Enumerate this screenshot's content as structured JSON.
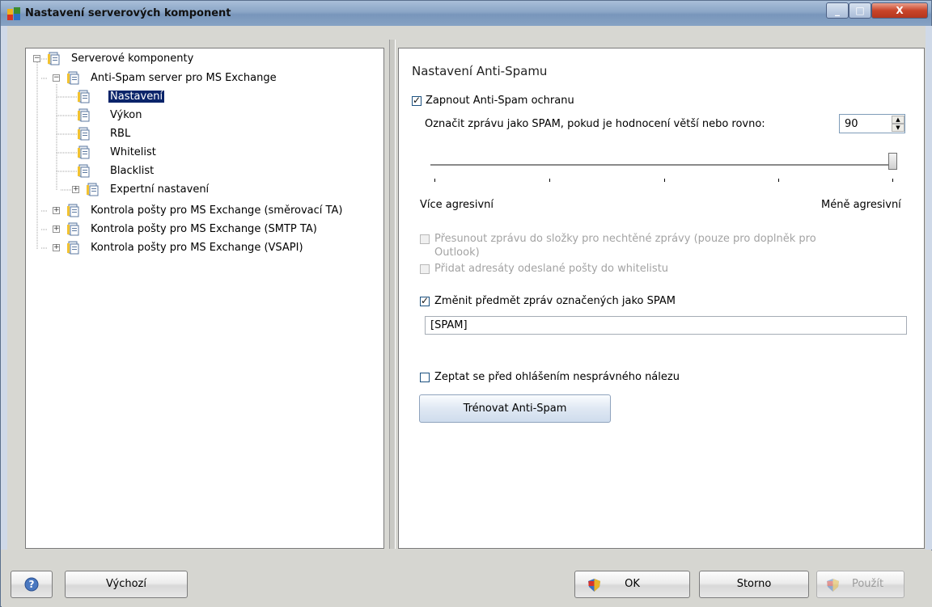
{
  "window": {
    "title": "Nastavení serverových komponent",
    "icon": "avg-app-icon",
    "controls": {
      "minimize": "minimize-icon",
      "maximize": "maximize-icon",
      "close": "close-icon"
    }
  },
  "tree": {
    "items": [
      {
        "label": "Serverové komponenty",
        "expander": "−",
        "level": 0
      },
      {
        "label": "Anti-Spam server pro MS Exchange",
        "expander": "−",
        "level": 1
      },
      {
        "label": "Nastavení",
        "level": 2,
        "selected": true
      },
      {
        "label": "Výkon",
        "level": 2
      },
      {
        "label": "RBL",
        "level": 2
      },
      {
        "label": "Whitelist",
        "level": 2
      },
      {
        "label": "Blacklist",
        "level": 2
      },
      {
        "label": "Expertní nastavení",
        "expander": "+",
        "level": 2
      },
      {
        "label": "Kontrola pošty pro MS Exchange (směrovací TA)",
        "expander": "+",
        "level": 1
      },
      {
        "label": "Kontrola pošty pro MS Exchange (SMTP TA)",
        "expander": "+",
        "level": 1
      },
      {
        "label": "Kontrola pošty pro MS Exchange (VSAPI)",
        "expander": "+",
        "level": 1
      }
    ]
  },
  "settings": {
    "title": "Nastavení Anti-Spamu",
    "enable_label": "Zapnout Anti-Spam ochranu",
    "enable_checked": true,
    "threshold_label": "Označit zprávu jako SPAM, pokud je hodnocení větší nebo rovno:",
    "threshold_value": "90",
    "slider": {
      "value": 90,
      "min": 0,
      "max": 100,
      "left_label": "Více agresivní",
      "right_label": "Méně agresivní"
    },
    "move_label": "Přesunout zprávu do složky pro nechtěné zprávy (pouze pro doplněk pro",
    "move_label_cont": "Outlook)",
    "move_checked": false,
    "add_whitelist_label": "Přidat adresáty odeslané pošty do whitelistu",
    "add_whitelist_checked": false,
    "subject_label": "Změnit předmět zpráv označených jako SPAM",
    "subject_checked": true,
    "subject_value": "[SPAM]",
    "ask_label": "Zeptat se před ohlášením nesprávného nálezu",
    "ask_checked": false,
    "train_button": "Trénovat Anti-Spam"
  },
  "footer": {
    "help_icon": "help-icon",
    "default_button": "Výchozí",
    "ok_button": "OK",
    "cancel_button": "Storno",
    "apply_button": "Použít"
  },
  "colors": {
    "selection": "#0a246a",
    "titlebar": "#8aa5c6",
    "close": "#c9452a"
  }
}
